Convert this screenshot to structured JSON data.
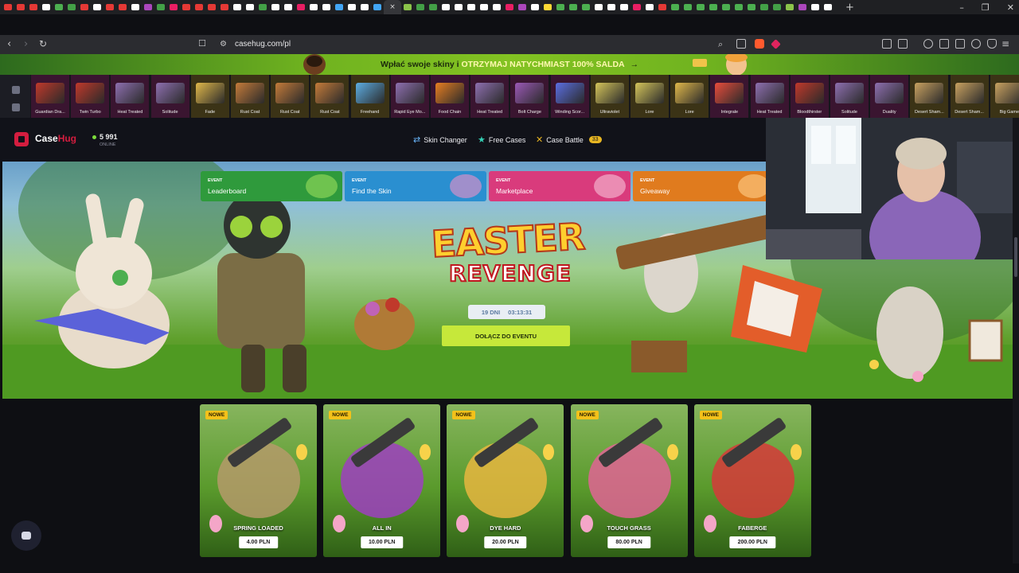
{
  "browser": {
    "url": "casehug.com/pl",
    "tab_colors": [
      "#e53935",
      "#e53935",
      "#e53935",
      "#ffffff",
      "#4caf50",
      "#43a047",
      "#e53935",
      "#ffffff",
      "#e53935",
      "#e53935",
      "#ffffff",
      "#ab47bc",
      "#43a047",
      "#e91e63",
      "#e53935",
      "#e53935",
      "#e53935",
      "#e53935",
      "#ffffff",
      "#ffffff",
      "#43a047",
      "#ffffff",
      "#ffffff",
      "#e91e63",
      "#ffffff",
      "#ffffff",
      "#42a5f5",
      "#ffffff",
      "#ffffff",
      "#42a5f5"
    ],
    "tab_colors_right": [
      "#8bc34a",
      "#43a047",
      "#43a047",
      "#ffffff",
      "#ffffff",
      "#ffffff",
      "#ffffff",
      "#ffffff",
      "#e91e63",
      "#ab47bc",
      "#ffffff",
      "#fdd835",
      "#4caf50",
      "#4caf50",
      "#4caf50",
      "#ffffff",
      "#ffffff",
      "#ffffff",
      "#e91e63",
      "#ffffff",
      "#e53935",
      "#4caf50",
      "#4caf50",
      "#4caf50",
      "#4caf50",
      "#4caf50",
      "#4caf50",
      "#4caf50",
      "#43a047",
      "#43a047",
      "#8bc34a",
      "#ab47bc",
      "#ffffff",
      "#ffffff"
    ],
    "active_tab_close": "×",
    "new_tab": "+",
    "window_controls": [
      "–",
      "❐",
      "✕"
    ]
  },
  "promo": {
    "lead": "Wpłać swoje skiny i",
    "highlight": "OTRZYMAJ NATYCHMIAST 100% SALDA",
    "arrow": "→"
  },
  "drops": [
    {
      "label": "Guardian Dra...",
      "color": "#c0392b",
      "bg": "#3a1530"
    },
    {
      "label": "Twin Turbo",
      "color": "#c0392b",
      "bg": "#3a1530"
    },
    {
      "label": "Heat Treated",
      "color": "#8e6fb0",
      "bg": "#3a1530"
    },
    {
      "label": "Solitude",
      "color": "#8e6fb0",
      "bg": "#3a1530"
    },
    {
      "label": "Fade",
      "color": "#e0b84a",
      "bg": "#3b3316"
    },
    {
      "label": "Rust Coat",
      "color": "#c47b3a",
      "bg": "#3b3316"
    },
    {
      "label": "Rust Coat",
      "color": "#c47b3a",
      "bg": "#3b3316"
    },
    {
      "label": "Rust Coat",
      "color": "#c47b3a",
      "bg": "#3b3316"
    },
    {
      "label": "Freehand",
      "color": "#5dade2",
      "bg": "#3b3316"
    },
    {
      "label": "Rapid Eye Mo...",
      "color": "#8e6fb0",
      "bg": "#3a1530"
    },
    {
      "label": "Food Chain",
      "color": "#e67e22",
      "bg": "#3a1530"
    },
    {
      "label": "Heat Treated",
      "color": "#8e6fb0",
      "bg": "#3a1530"
    },
    {
      "label": "Bolt Charge",
      "color": "#9b59b6",
      "bg": "#3a1530"
    },
    {
      "label": "Winding Scor...",
      "color": "#5b6ee1",
      "bg": "#3a1530"
    },
    {
      "label": "Ultraviolet",
      "color": "#d4c45a",
      "bg": "#3b3316"
    },
    {
      "label": "Lore",
      "color": "#d4c45a",
      "bg": "#3b3316"
    },
    {
      "label": "Lore",
      "color": "#e0b84a",
      "bg": "#3b3316"
    },
    {
      "label": "Integrale",
      "color": "#e74c3c",
      "bg": "#3a1530"
    },
    {
      "label": "Heat Treated",
      "color": "#8e6fb0",
      "bg": "#3a1530"
    },
    {
      "label": "Bloodthirster",
      "color": "#c0392b",
      "bg": "#3a1530"
    },
    {
      "label": "Solitude",
      "color": "#8e6fb0",
      "bg": "#3a1530"
    },
    {
      "label": "Duality",
      "color": "#8e6fb0",
      "bg": "#3a1530"
    },
    {
      "label": "Desert Sham...",
      "color": "#c8a160",
      "bg": "#3b3316"
    },
    {
      "label": "Desert Sham...",
      "color": "#c8a160",
      "bg": "#3b3316"
    },
    {
      "label": "Big Game",
      "color": "#c8a160",
      "bg": "#3b3316"
    }
  ],
  "header": {
    "logo_case": "Case",
    "logo_hug": "Hug",
    "online_count": "5 991",
    "online_label": "ONLINE",
    "nav": [
      {
        "label": "Skin Changer",
        "icon": "⇄",
        "icon_name": "swap-icon",
        "icon_color": "#6ab7ff"
      },
      {
        "label": "Free Cases",
        "icon": "★",
        "icon_name": "star-icon",
        "icon_color": "#34d1b6"
      },
      {
        "label": "Case Battle",
        "icon": "✕",
        "icon_name": "swords-icon",
        "icon_color": "#e8b622",
        "badge": "33"
      }
    ]
  },
  "events": [
    {
      "tag": "EVENT",
      "name": "Leaderboard",
      "bg": "#2f9a3c",
      "art": "#9be05c"
    },
    {
      "tag": "EVENT",
      "name": "Find the Skin",
      "bg": "#2a8fd0",
      "art": "#f090c8"
    },
    {
      "tag": "EVENT",
      "name": "Marketplace",
      "bg": "#d93b7c",
      "art": "#f6c3d8"
    },
    {
      "tag": "EVENT",
      "name": "Giveaway",
      "bg": "#e07b1e",
      "art": "#ffd08a"
    }
  ],
  "hero": {
    "title_line1": "EASTER",
    "title_line2": "REVENGE",
    "timer_days": "19 DNI",
    "timer_clock": "03:13:31",
    "join_label": "DOŁĄCZ DO EVENTU"
  },
  "cases": [
    {
      "badge": "NOWE",
      "name": "SPRING LOADED",
      "price": "4.00 PLN",
      "accent": "#b59a6a"
    },
    {
      "badge": "NOWE",
      "name": "ALL IN",
      "price": "10.00 PLN",
      "accent": "#9e3fbf"
    },
    {
      "badge": "NOWE",
      "name": "DYE HARD",
      "price": "20.00 PLN",
      "accent": "#e8b640"
    },
    {
      "badge": "NOWE",
      "name": "TOUCH GRASS",
      "price": "80.00 PLN",
      "accent": "#e06494"
    },
    {
      "badge": "NOWE",
      "name": "FABERGE",
      "price": "200.00 PLN",
      "accent": "#d63a3a"
    }
  ]
}
